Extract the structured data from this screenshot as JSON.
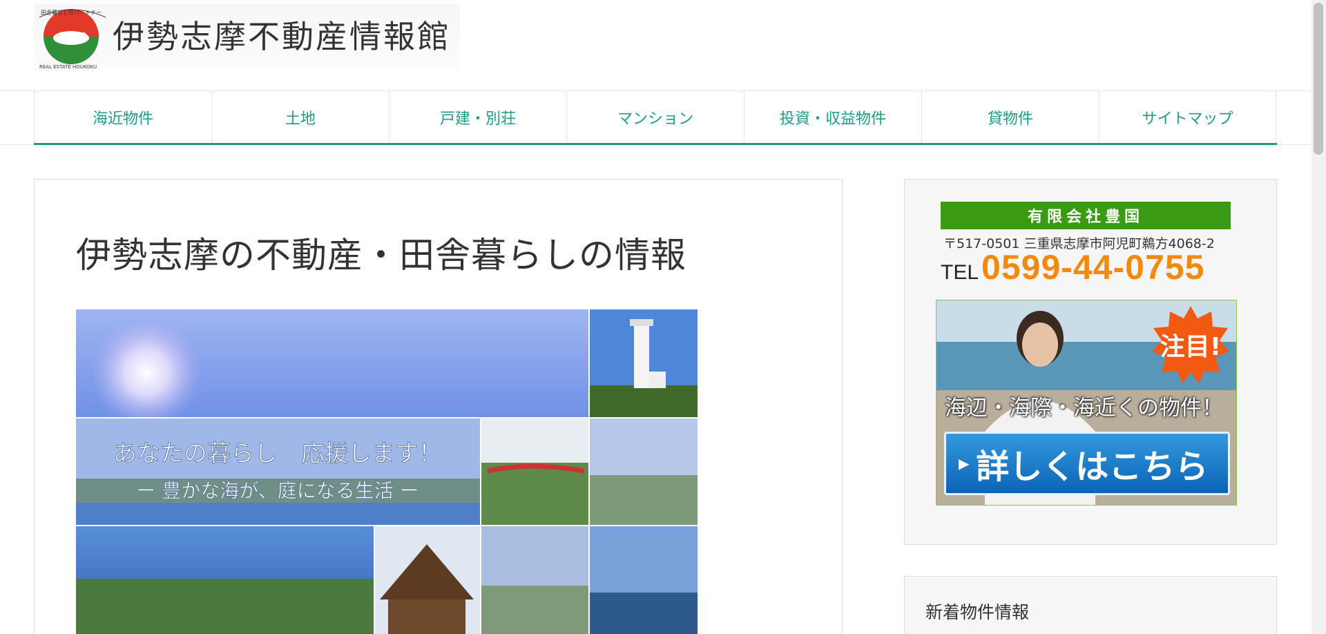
{
  "header": {
    "logo_small_text_top": "田舎暮らしのパートナー",
    "logo_small_text_bottom": "REAL ESTATE HOUKOKU",
    "site_title": "伊勢志摩不動産情報館"
  },
  "nav": {
    "items": [
      {
        "label": "海近物件"
      },
      {
        "label": "土地"
      },
      {
        "label": "戸建・別荘"
      },
      {
        "label": "マンション"
      },
      {
        "label": "投資・収益物件"
      },
      {
        "label": "貸物件"
      },
      {
        "label": "サイトマップ"
      }
    ]
  },
  "main": {
    "title": "伊勢志摩の不動産・田舎暮らしの情報",
    "hero": {
      "headline": "あなたの暮らし　応援します！",
      "subline": "ー 豊かな海が、庭になる生活 ー"
    }
  },
  "sidebar": {
    "company_name": "有限会社豊国",
    "address": "〒517-0501 三重県志摩市阿児町鵜方4068-2",
    "tel_label": "TEL",
    "tel_number": "0599-44-0755",
    "promo": {
      "badge": "注目!",
      "tagline": "海辺・海際・海近くの物件！",
      "cta": "詳しくはこちら"
    },
    "news_title": "新着物件情報"
  },
  "colors": {
    "accent": "#1f9a86",
    "company_green": "#3b9a14",
    "tel_orange": "#f28a12",
    "cta_blue": "#0b64b7"
  }
}
